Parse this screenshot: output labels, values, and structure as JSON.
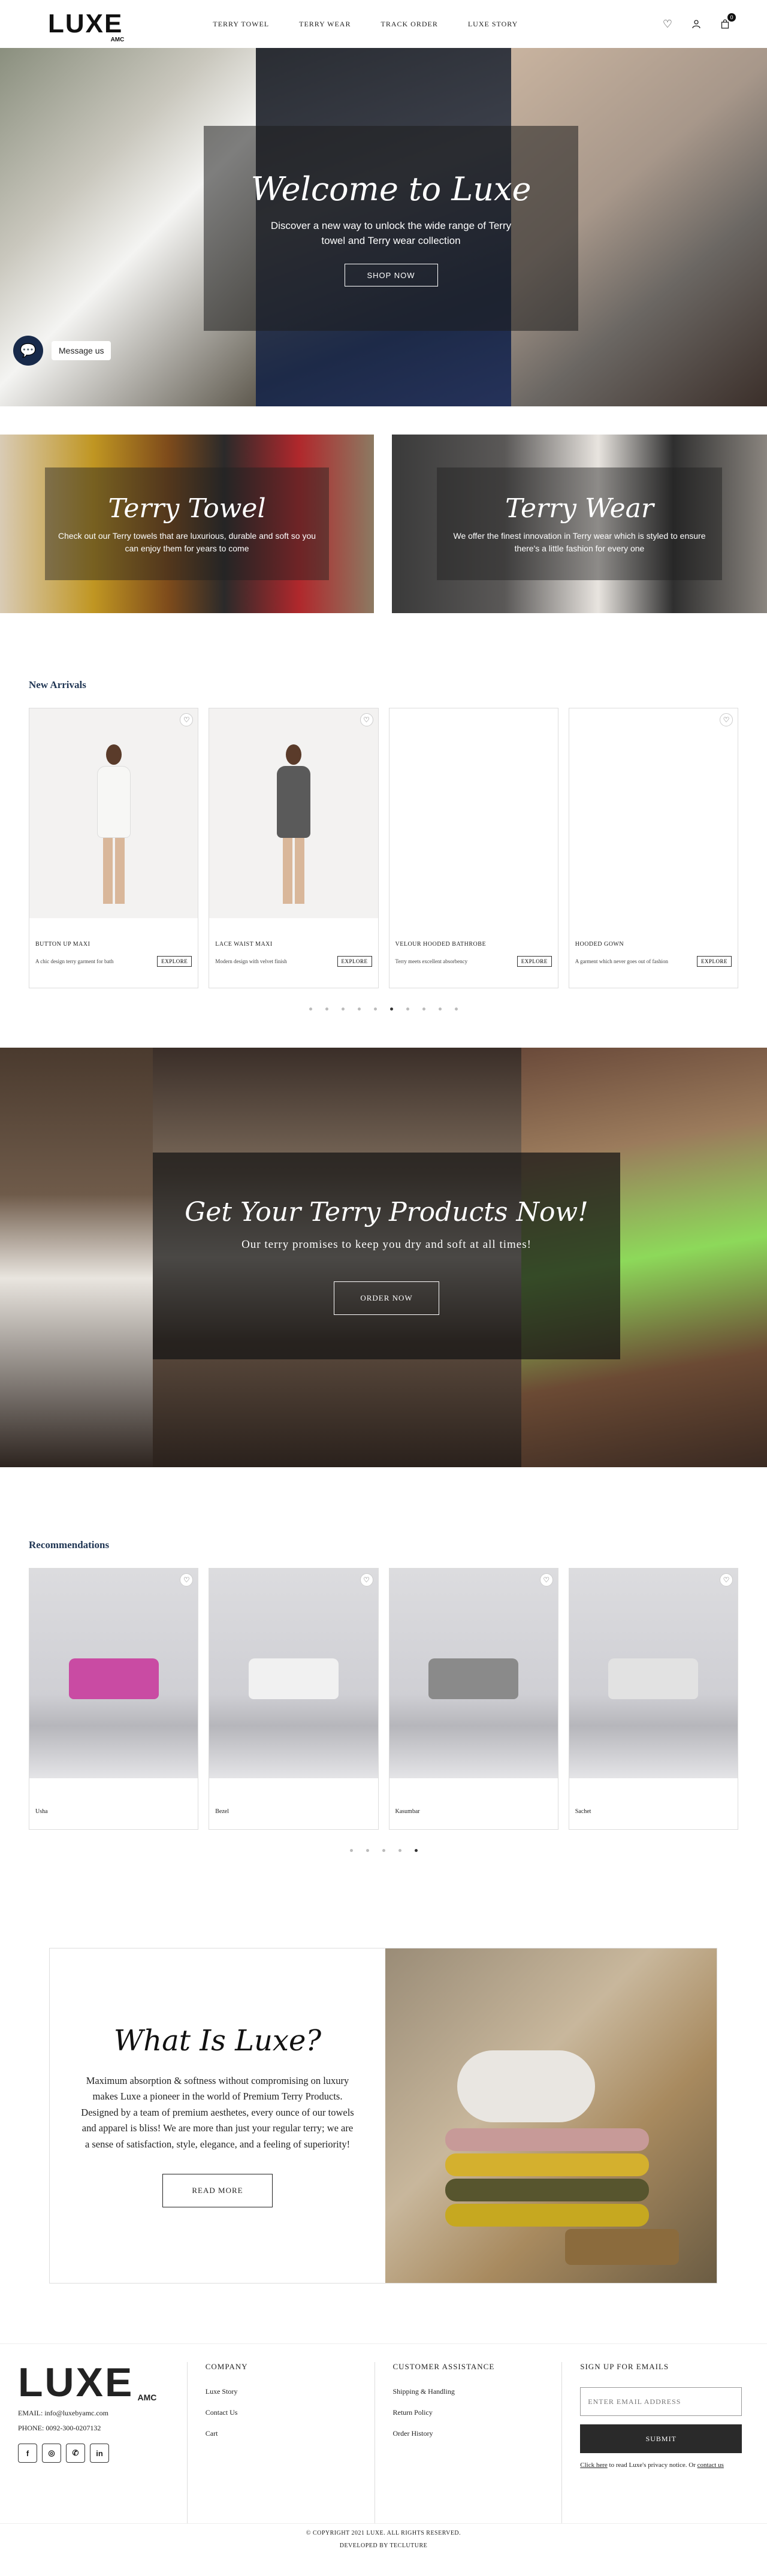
{
  "header": {
    "logo": "LUXE",
    "logo_sub": "AMC",
    "nav": [
      "TERRY TOWEL",
      "TERRY WEAR",
      "TRACK ORDER",
      "LUXE STORY"
    ],
    "cart_count": "0"
  },
  "hero": {
    "title": "Welcome to Luxe",
    "text": "Discover a new way to unlock the wide range of Terry towel and Terry wear collection",
    "button": "SHOP NOW",
    "chat_label": "Message us"
  },
  "categories": [
    {
      "title": "Terry Towel",
      "text": "Check out our Terry towels that are luxurious, durable and soft so you can enjoy them for years to come"
    },
    {
      "title": "Terry Wear",
      "text": "We offer the finest innovation in Terry wear which is styled to ensure there's a little fashion for every one"
    }
  ],
  "new_arrivals": {
    "title": "New Arrivals",
    "products": [
      {
        "name": "BUTTON UP MAXI",
        "desc": "A chic design terry garment for bath",
        "button": "EXPLORE"
      },
      {
        "name": "LACE WAIST MAXI",
        "desc": "Modern design with velvet finish",
        "button": "EXPLORE"
      },
      {
        "name": "VELOUR HOODED BATHROBE",
        "desc": "Terry meets excellent absorbency",
        "button": "EXPLORE"
      },
      {
        "name": "HOODED GOWN",
        "desc": "A garment which never goes out of fashion",
        "button": "EXPLORE"
      }
    ],
    "dots": 10,
    "active_dot": 5
  },
  "promo": {
    "title": "Get Your Terry Products Now!",
    "text": "Our terry promises to keep you dry and soft at all times!",
    "button": "ORDER NOW"
  },
  "recommendations": {
    "title": "Recommendations",
    "products": [
      {
        "name": "Usha",
        "color": "#c94ba3"
      },
      {
        "name": "Bezel",
        "color": "#f1f1f1"
      },
      {
        "name": "Kasumbar",
        "color": "#8a8a8a"
      },
      {
        "name": "Sachet",
        "color": "#e2e2e2"
      }
    ],
    "dots": 5,
    "active_dot": 4
  },
  "about": {
    "title": "What Is Luxe?",
    "text": "Maximum absorption & softness without compromising on luxury makes Luxe a pioneer in the world of Premium Terry Products. Designed by a team of premium aesthetes, every ounce of our towels and apparel is bliss! We are more than just your regular terry; we are a sense of satisfaction, style, elegance, and a feeling of superiority!",
    "button": "READ MORE"
  },
  "footer": {
    "logo": "LUXE",
    "logo_sub": "AMC",
    "email": "EMAIL:    info@luxebyamc.com",
    "phone": "PHONE:   0092-300-0207132",
    "socials": [
      "f",
      "◎",
      "✆",
      "in"
    ],
    "company_head": "COMPANY",
    "company_links": [
      "Luxe Story",
      "Contact Us",
      "Cart"
    ],
    "assist_head": "CUSTOMER ASSISTANCE",
    "assist_links": [
      "Shipping & Handling",
      "Return Policy",
      "Order History"
    ],
    "signup_head": "SIGN UP FOR EMAILS",
    "email_placeholder": "ENTER EMAIL ADDRESS",
    "submit": "SUBMIT",
    "privacy_link": "Click here",
    "privacy_text": " to read Luxe's privacy notice. Or ",
    "contact_link": "contact us",
    "copyright": "© COPYRIGHT 2021 LUXE. ALL RIGHTS RESERVED.",
    "developed": "DEVELOPED BY TECLUTURE"
  }
}
